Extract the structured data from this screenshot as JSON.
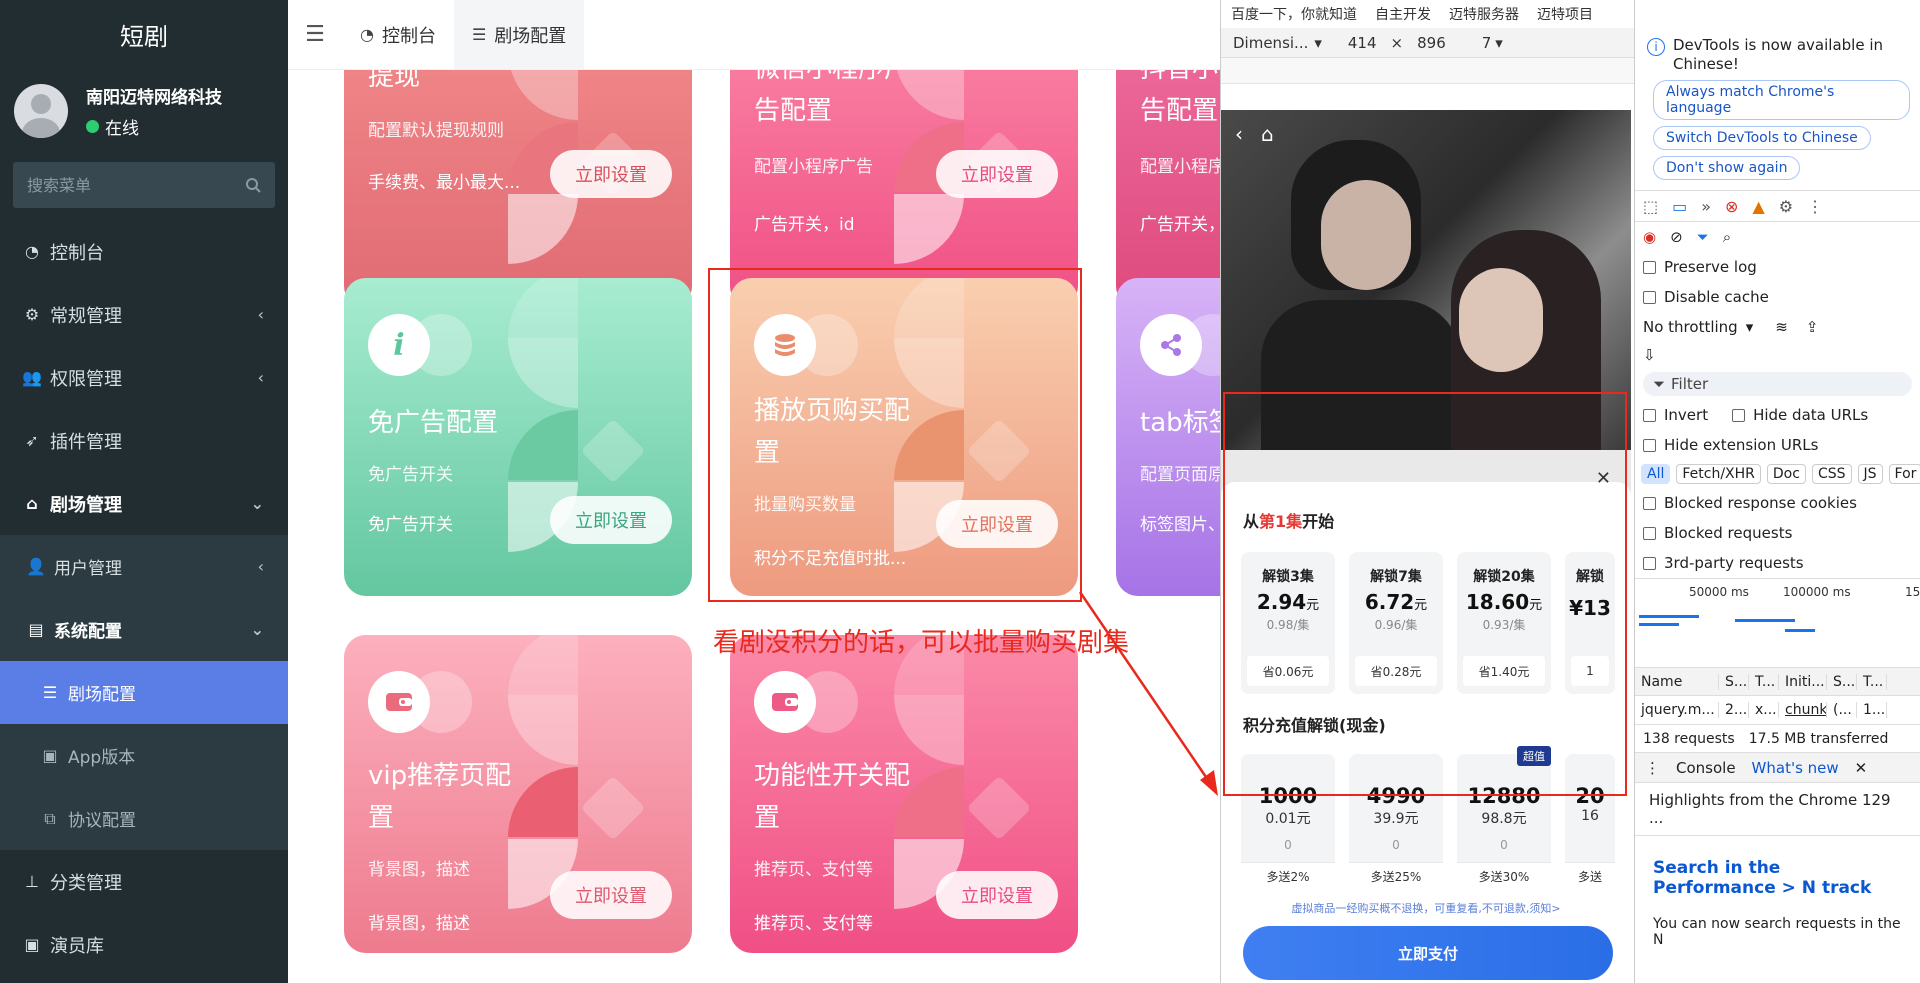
{
  "sidebar": {
    "brand": "短剧",
    "user_name": "南阳迈特网络科技",
    "user_status": "在线",
    "search_placeholder": "搜索菜单",
    "items": {
      "dashboard": "控制台",
      "general": "常规管理",
      "permission": "权限管理",
      "plugin": "插件管理",
      "theater": "剧场管理",
      "users": "用户管理",
      "sysconfig": "系统配置",
      "theater_config": "剧场配置",
      "app_version": "App版本",
      "agreement": "协议配置",
      "category": "分类管理",
      "actors": "演员库"
    }
  },
  "topnav": {
    "tab_dashboard": "控制台",
    "tab_theater_config": "剧场配置"
  },
  "cards": {
    "withdraw": {
      "title": "提现",
      "desc": "配置默认提现规则",
      "foot": "手续费、最小最大...",
      "button": "立即设置"
    },
    "miniprogram": {
      "title1": "微信小程序广",
      "title2": "告配置",
      "desc": "配置小程序广告",
      "foot": "广告开关，id",
      "button": "立即设置"
    },
    "douyin": {
      "title1": "抖音小",
      "title2": "告配置",
      "desc": "配置小程序",
      "foot": "广告开关，"
    },
    "noad": {
      "title": "免广告配置",
      "desc": "免广告开关",
      "foot": "免广告开关",
      "button": "立即设置"
    },
    "purchase": {
      "title1": "播放页购买配",
      "title2": "置",
      "desc": "批量购买数量",
      "foot": "积分不足充值时批...",
      "button": "立即设置"
    },
    "tab": {
      "title": "tab标签",
      "desc": "配置页面原",
      "foot": "标签图片、"
    },
    "vip": {
      "title1": "vip推荐页配",
      "title2": "置",
      "desc": "背景图，描述",
      "foot": "背景图，描述",
      "button": "立即设置"
    },
    "feature": {
      "title1": "功能性开关配",
      "title2": "置",
      "desc": "推荐页、支付等",
      "foot": "推荐页、支付等",
      "button": "立即设置"
    }
  },
  "annotation": "看剧没积分的话，可以批量购买剧集",
  "device": {
    "bookmarks": [
      "百度一下，你就知道",
      "自主开发",
      "迈特服务器",
      "迈特项目"
    ],
    "dimension_label": "Dimensi...",
    "width": "414",
    "times": "×",
    "height": "896",
    "zoom": "7"
  },
  "phone": {
    "from_prefix": "从",
    "from_ep": "第1集",
    "from_suffix": "开始",
    "packages": [
      {
        "title": "解锁3集",
        "price": "2.94",
        "yuan": "元",
        "unit": "0.98/集",
        "save": "省0.06元"
      },
      {
        "title": "解锁7集",
        "price": "6.72",
        "yuan": "元",
        "unit": "0.96/集",
        "save": "省0.28元"
      },
      {
        "title": "解锁20集",
        "price": "18.60",
        "yuan": "元",
        "unit": "0.93/集",
        "save": "省1.40元"
      },
      {
        "title": "解锁",
        "price": "¥13",
        "yuan": "",
        "unit": "",
        "save": "1"
      }
    ],
    "recharge_title": "积分充值解锁(现金)",
    "recharges": [
      {
        "points": "1000",
        "money": "0.01元",
        "zero": "0",
        "bonus": "多送2%"
      },
      {
        "points": "4990",
        "money": "39.9元",
        "zero": "0",
        "bonus": "多送25%"
      },
      {
        "points": "12880",
        "money": "98.8元",
        "zero": "0",
        "bonus": "多送30%",
        "tag": "超值"
      },
      {
        "points": "20",
        "money": "16",
        "zero": "",
        "bonus": "多送"
      }
    ],
    "note": "虚拟商品一经购买概不退换，可重复看,不可退款,须知>",
    "pay_button": "立即支付"
  },
  "devtools": {
    "cn_message": "DevTools is now available in Chinese!",
    "btn_match": "Always match Chrome's language",
    "btn_switch": "Switch DevTools to Chinese",
    "btn_dont": "Don't show again",
    "preserve_log": "Preserve log",
    "disable_cache": "Disable cache",
    "throttling": "No throttling",
    "filter": "Filter",
    "invert": "Invert",
    "hide_data_urls": "Hide data URLs",
    "hide_ext_urls": "Hide extension URLs",
    "types": [
      "All",
      "Fetch/XHR",
      "Doc",
      "CSS",
      "JS",
      "For"
    ],
    "blocked_cookies": "Blocked response cookies",
    "blocked_requests": "Blocked requests",
    "third_party": "3rd-party requests",
    "tick1": "50000 ms",
    "tick2": "100000 ms",
    "tick3": "15",
    "col_name": "Name",
    "col_s": "S...",
    "col_t": "T...",
    "col_init": "Initi...",
    "col_s2": "S...",
    "col_t2": "T...",
    "row_name": "jquery.m...",
    "row_s": "2...",
    "row_t": "x...",
    "row_init": "chunk-",
    "row_s2": "(...",
    "row_t2": "1...",
    "requests": "138 requests",
    "transferred": "17.5 MB transferred",
    "tab_console": "Console",
    "tab_whatsnew": "What's new",
    "highlights": "Highlights from the Chrome 129 ...",
    "news_title": "Search in the Performance > N track",
    "news_body": "You can now search requests in the N"
  }
}
